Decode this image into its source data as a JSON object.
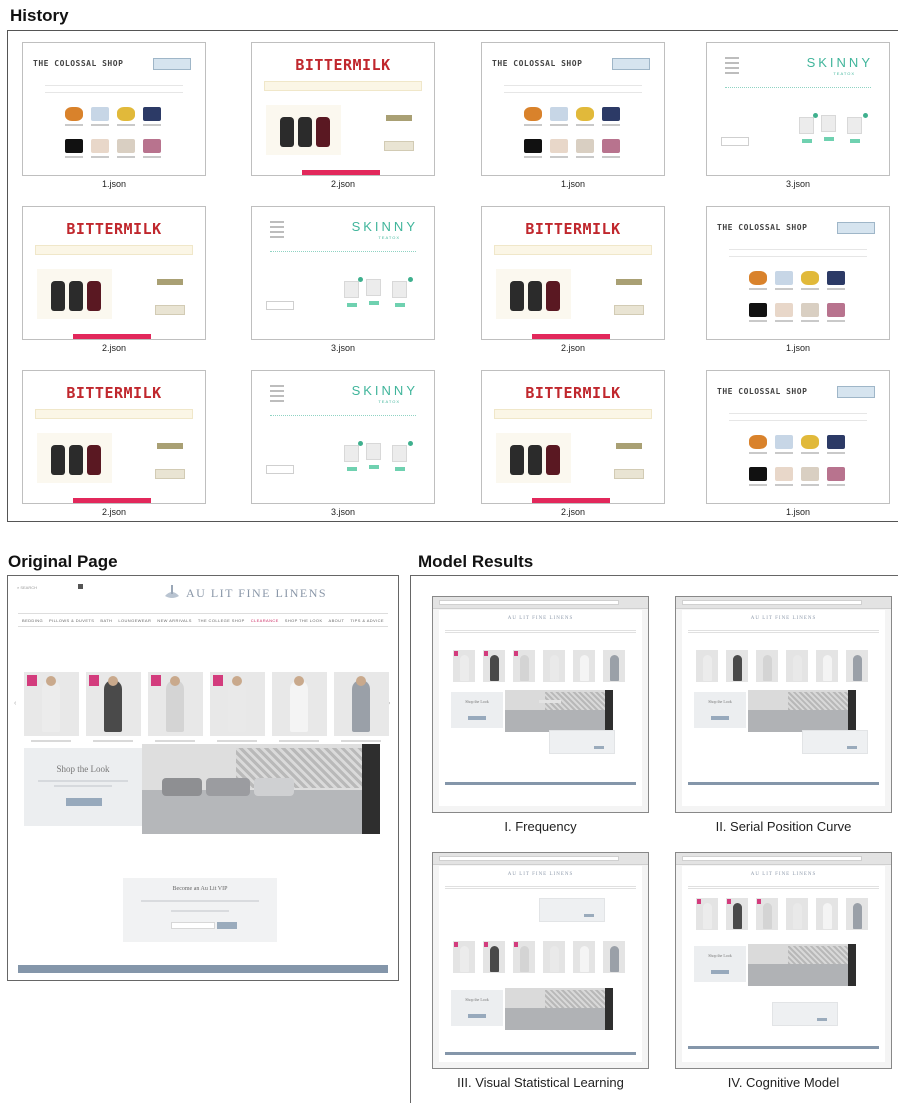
{
  "sections": {
    "history": "History",
    "original": "Original Page",
    "model": "Model Results"
  },
  "history": {
    "thumbs": [
      {
        "kind": "colossal",
        "logo": "THE COLOSSAL SHOP",
        "caption": "1.json"
      },
      {
        "kind": "bitter",
        "logo": "BITTERMILK",
        "caption": "2.json"
      },
      {
        "kind": "colossal",
        "logo": "THE COLOSSAL SHOP",
        "caption": "1.json"
      },
      {
        "kind": "skinny",
        "logo": "SKINNY",
        "sub": "TEATOX",
        "caption": "3.json"
      },
      {
        "kind": "bitter",
        "logo": "BITTERMILK",
        "caption": "2.json"
      },
      {
        "kind": "skinny",
        "logo": "SKINNY",
        "sub": "TEATOX",
        "caption": "3.json"
      },
      {
        "kind": "bitter",
        "logo": "BITTERMILK",
        "caption": "2.json"
      },
      {
        "kind": "colossal",
        "logo": "THE COLOSSAL SHOP",
        "caption": "1.json"
      },
      {
        "kind": "bitter",
        "logo": "BITTERMILK",
        "caption": "2.json"
      },
      {
        "kind": "skinny",
        "logo": "SKINNY",
        "sub": "TEATOX",
        "caption": "3.json"
      },
      {
        "kind": "bitter",
        "logo": "BITTERMILK",
        "caption": "2.json"
      },
      {
        "kind": "colossal",
        "logo": "THE COLOSSAL SHOP",
        "caption": "1.json"
      }
    ]
  },
  "original": {
    "brand": "AU LIT FINE LINENS",
    "nav": [
      "BEDDING",
      "PILLOWS & DUVETS",
      "BATH",
      "LOUNGEWEAR",
      "NEW ARRIVALS",
      "THE COLLEGE SHOP",
      "CLEARANCE",
      "SHOP THE LOOK",
      "ABOUT",
      "TIPS & ADVICE"
    ],
    "nav_highlight": "CLEARANCE",
    "shop_title": "Shop the Look",
    "vip_title": "Become an Au Lit VIP",
    "accent": "#cc2b63",
    "footer_color": "#8496aa"
  },
  "models": [
    {
      "caption": "I. Frequency",
      "layout": "freq"
    },
    {
      "caption": "II. Serial Position Curve",
      "layout": "serial"
    },
    {
      "caption": "III. Visual Statistical Learning",
      "layout": "visual"
    },
    {
      "caption": "IV. Cognitive Model",
      "layout": "cognitive"
    }
  ]
}
